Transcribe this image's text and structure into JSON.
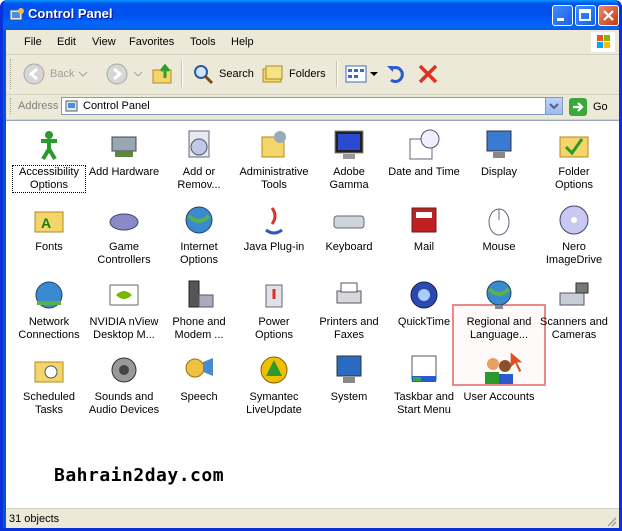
{
  "window": {
    "title": "Control Panel"
  },
  "menu": [
    "File",
    "Edit",
    "View",
    "Favorites",
    "Tools",
    "Help"
  ],
  "toolbar": {
    "back": "Back",
    "search": "Search",
    "folders": "Folders"
  },
  "address": {
    "label": "Address",
    "value": "Control Panel",
    "go": "Go"
  },
  "items": [
    {
      "label": "Accessibility Options",
      "icon": "accessibility-icon"
    },
    {
      "label": "Add Hardware",
      "icon": "add-hardware-icon"
    },
    {
      "label": "Add or Remov...",
      "icon": "add-remove-programs-icon"
    },
    {
      "label": "Administrative Tools",
      "icon": "administrative-tools-icon"
    },
    {
      "label": "Adobe Gamma",
      "icon": "adobe-gamma-icon"
    },
    {
      "label": "Date and Time",
      "icon": "date-time-icon"
    },
    {
      "label": "Display",
      "icon": "display-icon"
    },
    {
      "label": "Folder Options",
      "icon": "folder-options-icon"
    },
    {
      "label": "Fonts",
      "icon": "fonts-icon"
    },
    {
      "label": "Game Controllers",
      "icon": "game-controllers-icon"
    },
    {
      "label": "Internet Options",
      "icon": "internet-options-icon"
    },
    {
      "label": "Java Plug-in",
      "icon": "java-icon"
    },
    {
      "label": "Keyboard",
      "icon": "keyboard-icon"
    },
    {
      "label": "Mail",
      "icon": "mail-icon"
    },
    {
      "label": "Mouse",
      "icon": "mouse-icon"
    },
    {
      "label": "Nero ImageDrive",
      "icon": "nero-icon"
    },
    {
      "label": "Network Connections",
      "icon": "network-connections-icon"
    },
    {
      "label": "NVIDIA nView Desktop M...",
      "icon": "nvidia-icon"
    },
    {
      "label": "Phone and Modem ...",
      "icon": "phone-modem-icon"
    },
    {
      "label": "Power Options",
      "icon": "power-options-icon"
    },
    {
      "label": "Printers and Faxes",
      "icon": "printers-faxes-icon"
    },
    {
      "label": "QuickTime",
      "icon": "quicktime-icon"
    },
    {
      "label": "Regional and Language...",
      "icon": "regional-language-icon"
    },
    {
      "label": "Scanners and Cameras",
      "icon": "scanners-cameras-icon"
    },
    {
      "label": "Scheduled Tasks",
      "icon": "scheduled-tasks-icon"
    },
    {
      "label": "Sounds and Audio Devices",
      "icon": "sounds-audio-icon"
    },
    {
      "label": "Speech",
      "icon": "speech-icon"
    },
    {
      "label": "Symantec LiveUpdate",
      "icon": "symantec-liveupdate-icon"
    },
    {
      "label": "System",
      "icon": "system-icon"
    },
    {
      "label": "Taskbar and Start Menu",
      "icon": "taskbar-start-menu-icon"
    },
    {
      "label": "User Accounts",
      "icon": "user-accounts-icon"
    }
  ],
  "watermark": "Bahrain2day.com",
  "status": {
    "text": "31 objects"
  },
  "colors": {
    "title_bar": "#0053ee",
    "highlight_box": "#e88a8a",
    "selection": "#316ac5"
  }
}
